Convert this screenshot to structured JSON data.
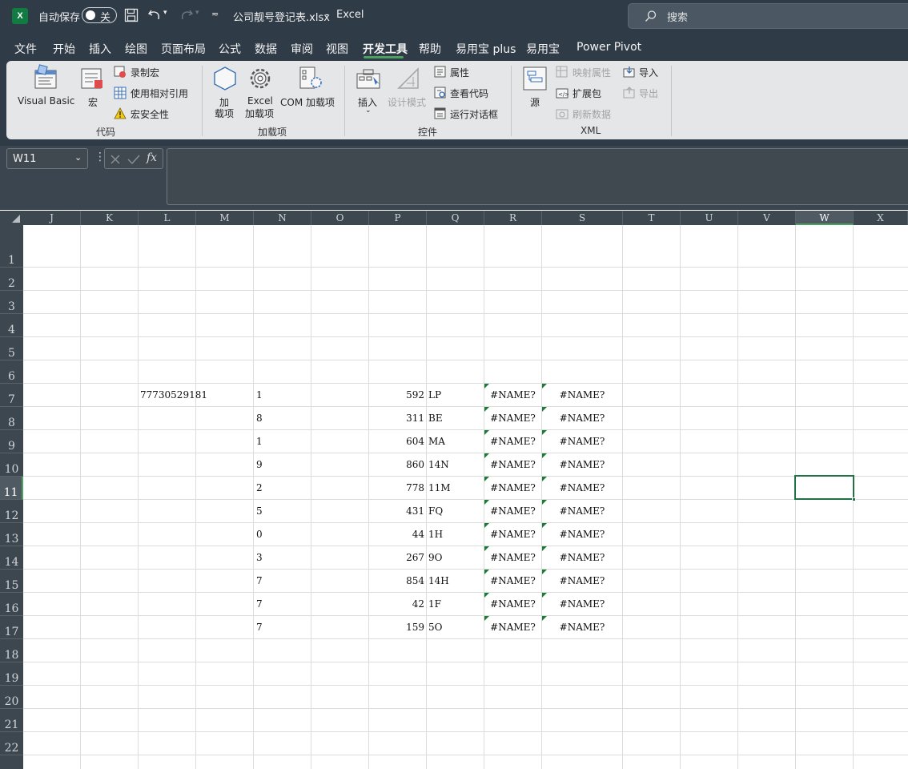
{
  "titlebar": {
    "autosave_label": "自动保存",
    "autosave_state": "关",
    "filename": "公司靓号登记表.xlsx",
    "separator": "-",
    "app_name": "Excel",
    "search_placeholder": "搜索"
  },
  "menu": {
    "items": [
      "文件",
      "开始",
      "插入",
      "绘图",
      "页面布局",
      "公式",
      "数据",
      "审阅",
      "视图",
      "开发工具",
      "帮助",
      "易用宝 plus",
      "易用宝",
      "Power Pivot"
    ],
    "active": "开发工具"
  },
  "ribbon": {
    "code": {
      "visual_basic": "Visual Basic",
      "macros": "宏",
      "record_macro": "录制宏",
      "relative_ref": "使用相对引用",
      "macro_security": "宏安全性",
      "group": "代码"
    },
    "addins": {
      "add_line1": "加",
      "add_line2": "载项",
      "excel_line1": "Excel",
      "excel_line2": "加载项",
      "com": "COM 加载项",
      "group": "加载项"
    },
    "controls": {
      "insert": "插入",
      "design_mode": "设计模式",
      "properties": "属性",
      "view_code": "查看代码",
      "run_dialog": "运行对话框",
      "group": "控件"
    },
    "xml": {
      "source": "源",
      "map_props": "映射属性",
      "expansion": "扩展包",
      "refresh": "刷新数据",
      "import": "导入",
      "export": "导出",
      "group": "XML"
    }
  },
  "formula_bar": {
    "name_box": "W11",
    "fx": "fx",
    "content": ""
  },
  "sheet": {
    "columns": [
      "J",
      "K",
      "L",
      "M",
      "N",
      "O",
      "P",
      "Q",
      "R",
      "S",
      "T",
      "U",
      "V",
      "W",
      "X"
    ],
    "selected_column": "W",
    "rows": [
      "1",
      "2",
      "3",
      "4",
      "5",
      "6",
      "7",
      "8",
      "9",
      "10",
      "11",
      "12",
      "13",
      "14",
      "15",
      "16",
      "17",
      "18",
      "19",
      "20",
      "21",
      "22"
    ],
    "selected_row": "11",
    "l7": "77730529181",
    "data_rows": [
      {
        "n": "1",
        "p": "592",
        "q": "LP",
        "r": "#NAME?",
        "s": "#NAME?"
      },
      {
        "n": "8",
        "p": "311",
        "q": "BE",
        "r": "#NAME?",
        "s": "#NAME?"
      },
      {
        "n": "1",
        "p": "604",
        "q": "MA",
        "r": "#NAME?",
        "s": "#NAME?"
      },
      {
        "n": "9",
        "p": "860",
        "q": "14N",
        "r": "#NAME?",
        "s": "#NAME?"
      },
      {
        "n": "2",
        "p": "778",
        "q": "11M",
        "r": "#NAME?",
        "s": "#NAME?"
      },
      {
        "n": "5",
        "p": "431",
        "q": "FQ",
        "r": "#NAME?",
        "s": "#NAME?"
      },
      {
        "n": "0",
        "p": "44",
        "q": "1H",
        "r": "#NAME?",
        "s": "#NAME?"
      },
      {
        "n": "3",
        "p": "267",
        "q": "9O",
        "r": "#NAME?",
        "s": "#NAME?"
      },
      {
        "n": "7",
        "p": "854",
        "q": "14H",
        "r": "#NAME?",
        "s": "#NAME?"
      },
      {
        "n": "7",
        "p": "42",
        "q": "1F",
        "r": "#NAME?",
        "s": "#NAME?"
      },
      {
        "n": "7",
        "p": "159",
        "q": "5O",
        "r": "#NAME?",
        "s": "#NAME?"
      }
    ]
  },
  "colors": {
    "accent": "#217346",
    "titlebar": "#2f3b46",
    "error_triangle": "#1b7b37"
  }
}
